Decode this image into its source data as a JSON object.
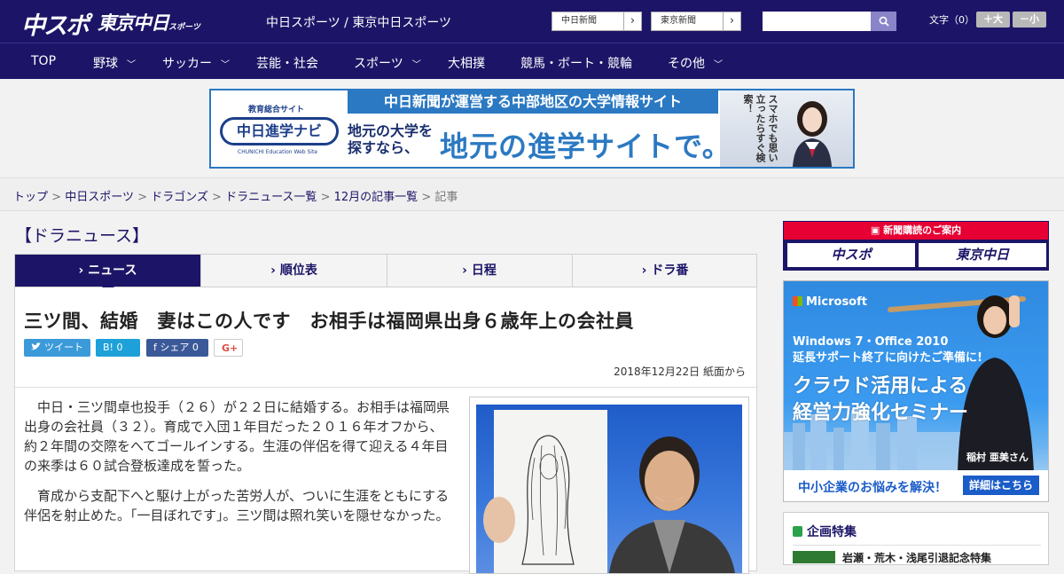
{
  "header": {
    "logo_chuspo": "中スポ",
    "logo_tokyo": "東京中日",
    "logo_tokyo_sub": "スポーツ",
    "site_names": "中日スポーツ / 東京中日スポーツ",
    "btn_chunichi": "中日新聞",
    "btn_tokyo": "東京新聞",
    "search_placeholder": "",
    "fontsize_label": "文字（0）",
    "font_plus": "＋大",
    "font_minus": "－小",
    "chevron": "›"
  },
  "nav": {
    "items": [
      {
        "label": "TOP",
        "dropdown": false
      },
      {
        "label": "野球",
        "dropdown": true
      },
      {
        "label": "サッカー",
        "dropdown": true
      },
      {
        "label": "芸能・社会",
        "dropdown": false
      },
      {
        "label": "スポーツ",
        "dropdown": true
      },
      {
        "label": "大相撲",
        "dropdown": false
      },
      {
        "label": "競馬・ボート・競輪",
        "dropdown": false
      },
      {
        "label": "その他",
        "dropdown": true
      }
    ]
  },
  "banner": {
    "edu_label": "教育総合サイト",
    "logo_text": "中日進学ナビ",
    "logo_sub": "CHUNICHI Education Web Site",
    "top_text": "中日新聞が運営する中部地区の大学情報サイト",
    "small_line1": "地元の大学を",
    "small_line2": "探すなら、",
    "big_text": "地元の進学サイトで。",
    "vertical_text": "スマホでも思い立ったらすぐ検索！"
  },
  "breadcrumb": {
    "items": [
      "トップ",
      "中日スポーツ",
      "ドラゴンズ",
      "ドラニュース一覧",
      "12月の記事一覧"
    ],
    "current": "記事",
    "separator": ">"
  },
  "section_title": "【ドラニュース】",
  "tabs": [
    {
      "label": "ニュース",
      "active": true
    },
    {
      "label": "順位表",
      "active": false
    },
    {
      "label": "日程",
      "active": false
    },
    {
      "label": "ドラ番",
      "active": false
    }
  ],
  "article": {
    "headline": "三ツ間、結婚　妻はこの人です　お相手は福岡県出身６歳年上の会社員",
    "share": {
      "tweet": "ツイート",
      "hatena": "B! 0",
      "facebook": "f シェア 0",
      "gplus": "G+"
    },
    "dateline": "2018年12月22日 紙面から",
    "paragraphs": [
      "中日・三ツ間卓也投手（２６）が２２日に結婚する。お相手は福岡県出身の会社員（３２）。育成で入団１年目だった２０１６年オフから、約２年間の交際をへてゴールインする。生涯の伴侶を得て迎える４年目の来季は６０試合登板達成を誓った。",
      "育成から支配下へと駆け上がった苦労人が、ついに生涯をともにする伴侶を射止めた。「一目ぼれです」。三ツ間は照れ笑いを隠せなかった。"
    ]
  },
  "sidebar": {
    "subscribe_head": "新聞購読のご案内",
    "subscribe_chuspo": "中スポ",
    "subscribe_tokyo": "東京中日",
    "ms_logo": "Microsoft",
    "ms_win_line1": "Windows 7・Office 2010",
    "ms_win_line2": "延長サポート終了に向けたご準備に!",
    "ms_big_line1": "クラウド活用による",
    "ms_big_line2": "経営力強化セミナー",
    "ms_name": "稲村 亜美さん",
    "ms_bottom_text": "中小企業のお悩みを解決！",
    "ms_bottom_btn": "詳細はこちら",
    "feature_head": "企画特集",
    "feature_line": "岩瀬・荒木・浅尾引退記念特集"
  },
  "colors": {
    "brand_navy": "#1c1567",
    "accent_blue": "#2b79c2",
    "alert_red": "#e60033"
  }
}
